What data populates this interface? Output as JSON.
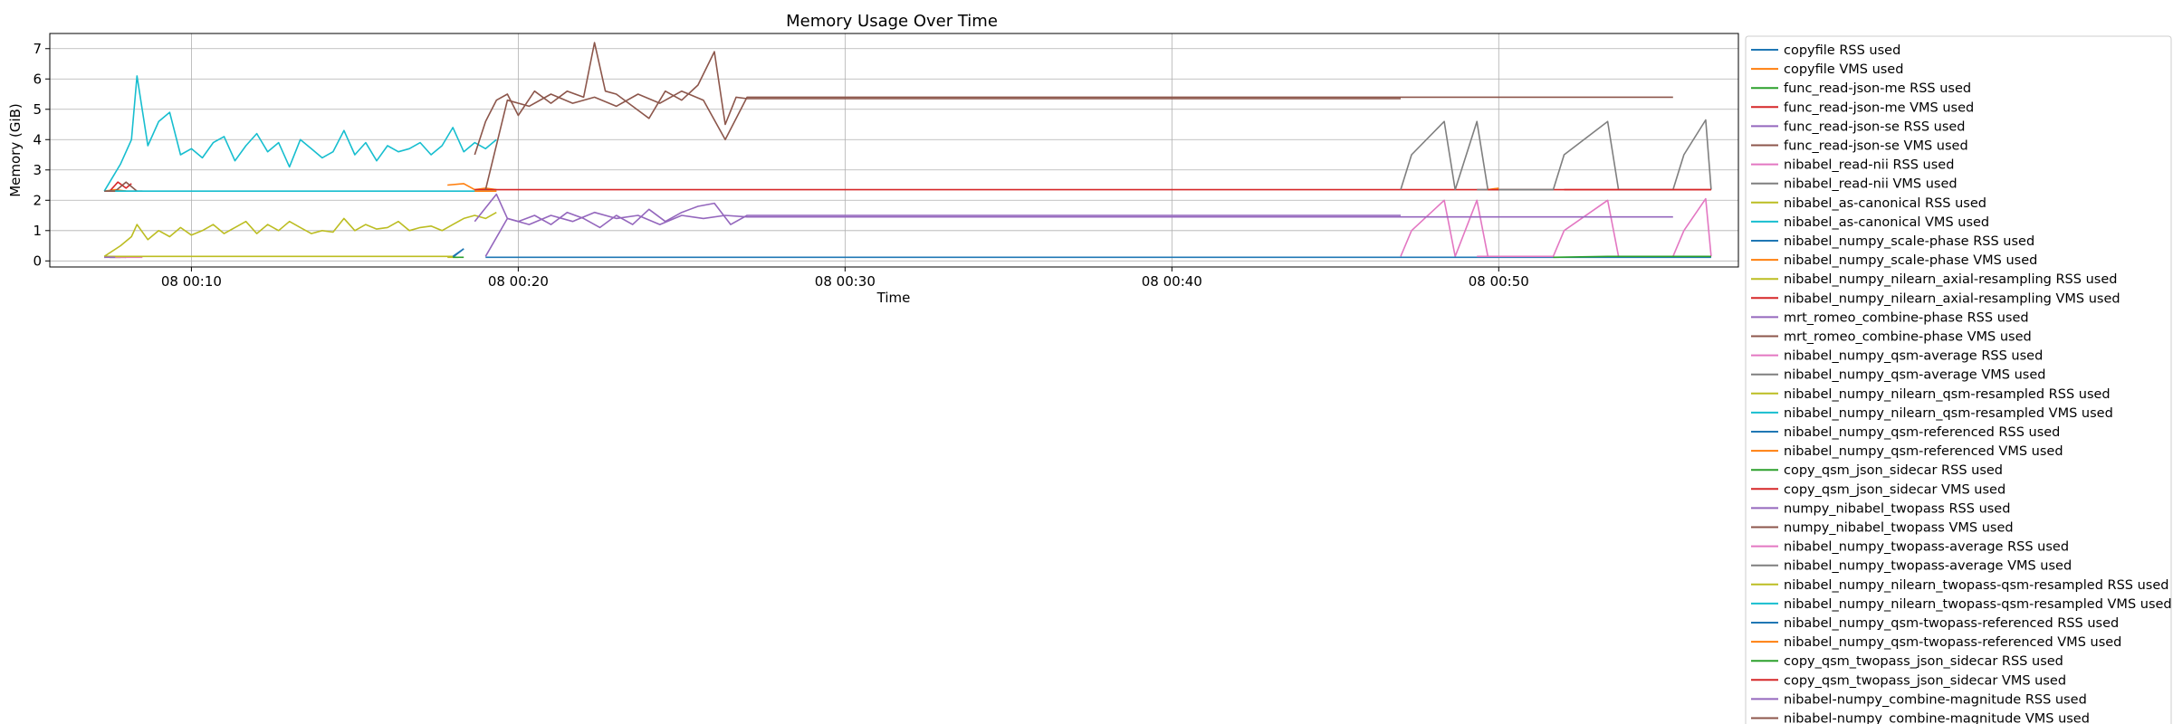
{
  "chart_data": {
    "type": "line",
    "title": "Memory Usage Over Time",
    "xlabel": "Time",
    "ylabel": "Memory (GiB)",
    "xlim": [
      "08 00:05:40",
      "08 00:57:20"
    ],
    "ylim": [
      -0.2,
      7.5
    ],
    "xticks": [
      {
        "t": "08 00:10:00",
        "label": "08 00:10"
      },
      {
        "t": "08 00:20:00",
        "label": "08 00:20"
      },
      {
        "t": "08 00:30:00",
        "label": "08 00:30"
      },
      {
        "t": "08 00:40:00",
        "label": "08 00:40"
      },
      {
        "t": "08 00:50:00",
        "label": "08 00:50"
      }
    ],
    "yticks": [
      0,
      1,
      2,
      3,
      4,
      5,
      6,
      7
    ],
    "grid": true,
    "legend": {
      "placement": "outside-right"
    },
    "series": [
      {
        "name": "copyfile RSS used",
        "color": "#1f77b4",
        "x": [
          "08 00:07:20",
          "08 00:07:40",
          "08 00:08:00"
        ],
        "y": [
          0.12,
          0.15,
          0.12
        ]
      },
      {
        "name": "copyfile VMS used",
        "color": "#ff7f0e",
        "x": [
          "08 00:07:20",
          "08 00:07:40",
          "08 00:08:00"
        ],
        "y": [
          2.3,
          2.35,
          2.3
        ]
      },
      {
        "name": "func_read-json-me RSS used",
        "color": "#2ca02c",
        "x": [
          "08 00:07:30",
          "08 00:07:50"
        ],
        "y": [
          0.12,
          0.12
        ]
      },
      {
        "name": "func_read-json-me VMS used",
        "color": "#d62728",
        "x": [
          "08 00:07:30",
          "08 00:07:45",
          "08 00:08:00",
          "08 00:08:10"
        ],
        "y": [
          2.3,
          2.6,
          2.4,
          2.55
        ]
      },
      {
        "name": "func_read-json-se RSS used",
        "color": "#9467bd",
        "x": [
          "08 00:07:40",
          "08 00:08:00"
        ],
        "y": [
          0.12,
          0.12
        ]
      },
      {
        "name": "func_read-json-se VMS used",
        "color": "#8c564b",
        "x": [
          "08 00:07:40",
          "08 00:08:00",
          "08 00:08:20"
        ],
        "y": [
          2.3,
          2.6,
          2.3
        ]
      },
      {
        "name": "nibabel_read-nii RSS used",
        "color": "#e377c2",
        "x": [
          "08 00:07:30",
          "08 00:08:30"
        ],
        "y": [
          0.12,
          0.12
        ]
      },
      {
        "name": "nibabel_read-nii VMS used",
        "color": "#7f7f7f",
        "x": [
          "08 00:07:30",
          "08 00:08:30"
        ],
        "y": [
          2.3,
          2.3
        ]
      },
      {
        "name": "nibabel_as-canonical RSS used",
        "color": "#bcbd22",
        "x": [
          "08 00:07:20",
          "08 00:07:50",
          "08 00:08:10",
          "08 00:08:20",
          "08 00:08:40",
          "08 00:09:00",
          "08 00:09:20",
          "08 00:09:40",
          "08 00:10:00",
          "08 00:10:20",
          "08 00:10:40",
          "08 00:11:00",
          "08 00:11:20",
          "08 00:11:40",
          "08 00:12:00",
          "08 00:12:20",
          "08 00:12:40",
          "08 00:13:00",
          "08 00:13:20",
          "08 00:13:40",
          "08 00:14:00",
          "08 00:14:20",
          "08 00:14:40",
          "08 00:15:00",
          "08 00:15:20",
          "08 00:15:40",
          "08 00:16:00",
          "08 00:16:20",
          "08 00:16:40",
          "08 00:17:00",
          "08 00:17:20",
          "08 00:17:40",
          "08 00:18:00",
          "08 00:18:20",
          "08 00:18:40",
          "08 00:19:00",
          "08 00:19:20"
        ],
        "y": [
          0.15,
          0.5,
          0.8,
          1.2,
          0.7,
          1.0,
          0.8,
          1.1,
          0.85,
          1.0,
          1.2,
          0.9,
          1.1,
          1.3,
          0.9,
          1.2,
          1.0,
          1.3,
          1.1,
          0.9,
          1.0,
          0.95,
          1.4,
          1.0,
          1.2,
          1.05,
          1.1,
          1.3,
          1.0,
          1.1,
          1.15,
          1.0,
          1.2,
          1.4,
          1.5,
          1.4,
          1.6
        ]
      },
      {
        "name": "nibabel_as-canonical VMS used",
        "color": "#17becf",
        "x": [
          "08 00:07:20",
          "08 00:07:50",
          "08 00:08:10",
          "08 00:08:20",
          "08 00:08:40",
          "08 00:09:00",
          "08 00:09:20",
          "08 00:09:40",
          "08 00:10:00",
          "08 00:10:20",
          "08 00:10:40",
          "08 00:11:00",
          "08 00:11:20",
          "08 00:11:40",
          "08 00:12:00",
          "08 00:12:20",
          "08 00:12:40",
          "08 00:13:00",
          "08 00:13:20",
          "08 00:13:40",
          "08 00:14:00",
          "08 00:14:20",
          "08 00:14:40",
          "08 00:15:00",
          "08 00:15:20",
          "08 00:15:40",
          "08 00:16:00",
          "08 00:16:20",
          "08 00:16:40",
          "08 00:17:00",
          "08 00:17:20",
          "08 00:17:40",
          "08 00:18:00",
          "08 00:18:20",
          "08 00:18:40",
          "08 00:19:00",
          "08 00:19:20"
        ],
        "y": [
          2.3,
          3.2,
          4.0,
          6.1,
          3.8,
          4.6,
          4.9,
          3.5,
          3.7,
          3.4,
          3.9,
          4.1,
          3.3,
          3.8,
          4.2,
          3.6,
          3.9,
          3.1,
          4.0,
          3.7,
          3.4,
          3.6,
          4.3,
          3.5,
          3.9,
          3.3,
          3.8,
          3.6,
          3.7,
          3.9,
          3.5,
          3.8,
          4.4,
          3.6,
          3.9,
          3.7,
          4.0
        ]
      },
      {
        "name": "nibabel_numpy_scale-phase RSS used",
        "color": "#1f77b4",
        "x": [
          "08 00:18:00",
          "08 00:18:20"
        ],
        "y": [
          0.15,
          0.4
        ]
      },
      {
        "name": "nibabel_numpy_scale-phase VMS used",
        "color": "#ff7f0e",
        "x": [
          "08 00:17:50",
          "08 00:18:20",
          "08 00:18:40",
          "08 00:19:00",
          "08 00:19:20"
        ],
        "y": [
          2.5,
          2.55,
          2.35,
          2.4,
          2.35
        ]
      },
      {
        "name": "nibabel_numpy_nilearn_axial-resampling RSS used",
        "color": "#bcbd22",
        "x": [
          "08 00:17:50",
          "08 00:18:10"
        ],
        "y": [
          0.12,
          0.12
        ]
      },
      {
        "name": "nibabel_numpy_nilearn_axial-resampling VMS used",
        "color": "#d62728",
        "x": [
          "08 00:18:40",
          "08 00:30:00",
          "08 00:40:00",
          "08 00:50:00",
          "08 00:56:30"
        ],
        "y": [
          2.35,
          2.35,
          2.35,
          2.35,
          2.35
        ]
      },
      {
        "name": "mrt_romeo_combine-phase RSS used",
        "color": "#9467bd",
        "x": [
          "08 00:18:40",
          "08 00:19:20",
          "08 00:19:40",
          "08 00:20:00",
          "08 00:20:30",
          "08 00:21:00",
          "08 00:21:30",
          "08 00:22:00",
          "08 00:22:30",
          "08 00:23:00",
          "08 00:23:30",
          "08 00:24:00",
          "08 00:24:30",
          "08 00:25:00",
          "08 00:25:30",
          "08 00:26:00",
          "08 00:26:30",
          "08 00:27:00",
          "08 00:30:00",
          "08 00:40:00",
          "08 00:47:00"
        ],
        "y": [
          1.3,
          2.2,
          1.4,
          1.3,
          1.5,
          1.2,
          1.6,
          1.4,
          1.1,
          1.5,
          1.2,
          1.7,
          1.3,
          1.6,
          1.8,
          1.9,
          1.2,
          1.5,
          1.5,
          1.5,
          1.5
        ]
      },
      {
        "name": "mrt_romeo_combine-phase VMS used",
        "color": "#8c564b",
        "x": [
          "08 00:18:40",
          "08 00:19:00",
          "08 00:19:20",
          "08 00:19:40",
          "08 00:20:00",
          "08 00:20:30",
          "08 00:21:00",
          "08 00:21:30",
          "08 00:22:00",
          "08 00:22:20",
          "08 00:22:40",
          "08 00:23:00",
          "08 00:23:30",
          "08 00:24:00",
          "08 00:24:30",
          "08 00:25:00",
          "08 00:25:30",
          "08 00:26:00",
          "08 00:26:20",
          "08 00:26:40",
          "08 00:27:00",
          "08 00:30:00",
          "08 00:40:00",
          "08 00:47:00"
        ],
        "y": [
          3.5,
          4.6,
          5.3,
          5.5,
          4.8,
          5.6,
          5.2,
          5.6,
          5.4,
          7.2,
          5.6,
          5.5,
          5.1,
          4.7,
          5.6,
          5.3,
          5.8,
          6.9,
          4.5,
          5.4,
          5.35,
          5.35,
          5.35,
          5.35
        ]
      },
      {
        "name": "nibabel_numpy_qsm-average RSS used",
        "color": "#e377c2",
        "x": [
          "08 00:47:00",
          "08 00:47:20",
          "08 00:48:20",
          "08 00:48:40",
          "08 00:49:20",
          "08 00:49:40",
          "08 00:51:40",
          "08 00:52:00",
          "08 00:53:20",
          "08 00:53:40",
          "08 00:55:20",
          "08 00:55:40",
          "08 00:56:20",
          "08 00:56:30"
        ],
        "y": [
          0.15,
          1.0,
          2.0,
          0.15,
          2.0,
          0.15,
          0.15,
          1.0,
          2.0,
          0.15,
          0.15,
          1.0,
          2.05,
          0.15
        ]
      },
      {
        "name": "nibabel_numpy_qsm-average VMS used",
        "color": "#7f7f7f",
        "x": [
          "08 00:47:00",
          "08 00:47:20",
          "08 00:48:20",
          "08 00:48:40",
          "08 00:49:20",
          "08 00:49:40",
          "08 00:51:40",
          "08 00:52:00",
          "08 00:53:20",
          "08 00:53:40",
          "08 00:55:20",
          "08 00:55:40",
          "08 00:56:20",
          "08 00:56:30"
        ],
        "y": [
          2.35,
          3.5,
          4.6,
          2.35,
          4.6,
          2.35,
          2.35,
          3.5,
          4.6,
          2.35,
          2.35,
          3.5,
          4.65,
          2.35
        ]
      },
      {
        "name": "nibabel_numpy_nilearn_qsm-resampled RSS used",
        "color": "#bcbd22",
        "x": [
          "08 00:07:20",
          "08 00:18:00"
        ],
        "y": [
          0.15,
          0.15
        ]
      },
      {
        "name": "nibabel_numpy_nilearn_qsm-resampled VMS used",
        "color": "#17becf",
        "x": [
          "08 00:07:20",
          "08 00:18:00",
          "08 00:19:20"
        ],
        "y": [
          2.3,
          2.3,
          2.3
        ]
      },
      {
        "name": "nibabel_numpy_qsm-referenced RSS used",
        "color": "#1f77b4",
        "x": [
          "08 00:19:00",
          "08 00:30:00",
          "08 00:40:00",
          "08 00:50:00",
          "08 00:56:30"
        ],
        "y": [
          0.12,
          0.12,
          0.12,
          0.12,
          0.12
        ]
      },
      {
        "name": "nibabel_numpy_qsm-referenced VMS used",
        "color": "#ff7f0e",
        "x": [
          "08 00:18:40",
          "08 00:19:20"
        ],
        "y": [
          2.3,
          2.3
        ]
      },
      {
        "name": "copy_qsm_json_sidecar RSS used",
        "color": "#2ca02c",
        "x": [
          "08 00:51:40",
          "08 00:53:20",
          "08 00:55:20",
          "08 00:56:30"
        ],
        "y": [
          0.12,
          0.15,
          0.15,
          0.15
        ]
      },
      {
        "name": "copy_qsm_json_sidecar VMS used",
        "color": "#d62728",
        "x": [
          "08 00:52:00",
          "08 00:56:30"
        ],
        "y": [
          2.35,
          2.35
        ]
      },
      {
        "name": "numpy_nibabel_twopass RSS used",
        "color": "#9467bd",
        "x": [
          "08 00:19:00",
          "08 00:19:40",
          "08 00:20:20",
          "08 00:21:00",
          "08 00:21:40",
          "08 00:22:20",
          "08 00:23:00",
          "08 00:23:40",
          "08 00:24:20",
          "08 00:25:00",
          "08 00:25:40",
          "08 00:26:20",
          "08 00:27:00",
          "08 00:30:00",
          "08 00:40:00",
          "08 00:50:00",
          "08 00:55:20"
        ],
        "y": [
          0.15,
          1.4,
          1.2,
          1.5,
          1.3,
          1.6,
          1.4,
          1.5,
          1.2,
          1.5,
          1.4,
          1.5,
          1.45,
          1.45,
          1.45,
          1.45,
          1.45
        ]
      },
      {
        "name": "numpy_nibabel_twopass VMS used",
        "color": "#8c564b",
        "x": [
          "08 00:19:00",
          "08 00:19:40",
          "08 00:20:20",
          "08 00:21:00",
          "08 00:21:40",
          "08 00:22:20",
          "08 00:23:00",
          "08 00:23:40",
          "08 00:24:20",
          "08 00:25:00",
          "08 00:25:40",
          "08 00:26:20",
          "08 00:27:00",
          "08 00:30:00",
          "08 00:40:00",
          "08 00:50:00",
          "08 00:55:20"
        ],
        "y": [
          2.35,
          5.3,
          5.1,
          5.5,
          5.2,
          5.4,
          5.1,
          5.5,
          5.2,
          5.6,
          5.3,
          4.0,
          5.4,
          5.4,
          5.4,
          5.4,
          5.4
        ]
      },
      {
        "name": "nibabel_numpy_twopass-average RSS used",
        "color": "#e377c2",
        "x": [
          "08 00:49:20",
          "08 00:50:00",
          "08 00:51:40"
        ],
        "y": [
          0.15,
          0.15,
          0.15
        ]
      },
      {
        "name": "nibabel_numpy_twopass-average VMS used",
        "color": "#7f7f7f",
        "x": [
          "08 00:49:20",
          "08 00:51:40"
        ],
        "y": [
          2.35,
          2.35
        ]
      },
      {
        "name": "nibabel_numpy_nilearn_twopass-qsm-resampled RSS used",
        "color": "#bcbd22",
        "x": [
          "08 00:07:20",
          "08 00:08:00"
        ],
        "y": [
          0.15,
          0.15
        ]
      },
      {
        "name": "nibabel_numpy_nilearn_twopass-qsm-resampled VMS used",
        "color": "#17becf",
        "x": [
          "08 00:07:20",
          "08 00:08:00"
        ],
        "y": [
          2.3,
          2.3
        ]
      },
      {
        "name": "nibabel_numpy_qsm-twopass-referenced RSS used",
        "color": "#1f77b4",
        "x": [
          "08 00:18:00",
          "08 00:18:20"
        ],
        "y": [
          0.12,
          0.4
        ]
      },
      {
        "name": "nibabel_numpy_qsm-twopass-referenced VMS used",
        "color": "#ff7f0e",
        "x": [
          "08 00:49:40",
          "08 00:50:00"
        ],
        "y": [
          2.35,
          2.4
        ]
      },
      {
        "name": "copy_qsm_twopass_json_sidecar RSS used",
        "color": "#2ca02c",
        "x": [
          "08 00:18:00",
          "08 00:18:20"
        ],
        "y": [
          0.12,
          0.12
        ]
      },
      {
        "name": "copy_qsm_twopass_json_sidecar VMS used",
        "color": "#d62728",
        "x": [
          "08 00:49:40",
          "08 00:50:00"
        ],
        "y": [
          2.35,
          2.35
        ]
      },
      {
        "name": "nibabel-numpy_combine-magnitude RSS used",
        "color": "#9467bd",
        "x": [
          "08 00:07:20",
          "08 00:07:40"
        ],
        "y": [
          0.12,
          0.12
        ]
      },
      {
        "name": "nibabel-numpy_combine-magnitude VMS used",
        "color": "#8c564b",
        "x": [
          "08 00:07:20",
          "08 00:07:40"
        ],
        "y": [
          2.3,
          2.3
        ]
      }
    ]
  }
}
